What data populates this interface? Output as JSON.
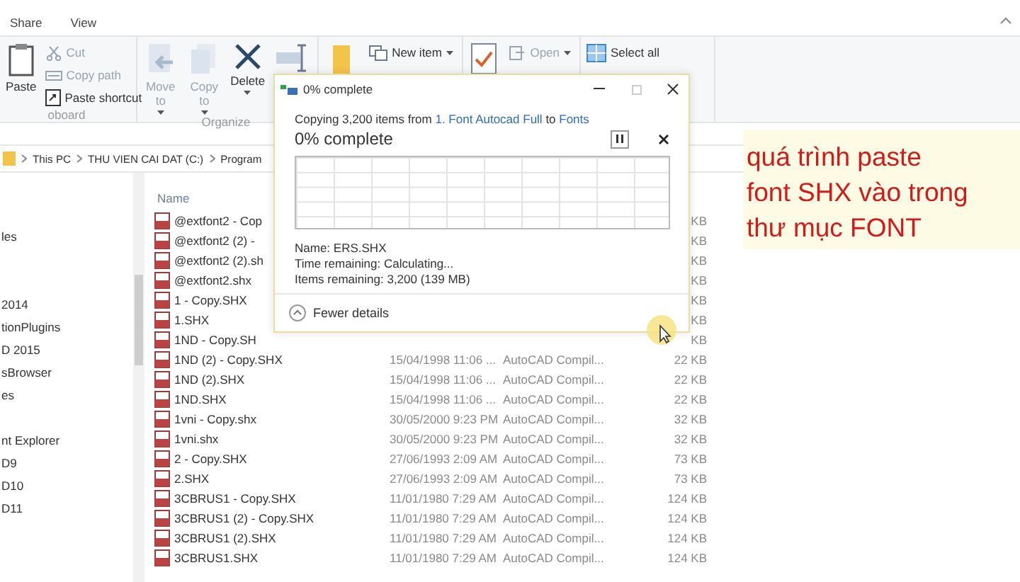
{
  "ribbon_tabs": [
    "Share",
    "View"
  ],
  "ribbon_groups": [
    {
      "label": "oboard",
      "buttons": [
        {
          "label": "Paste",
          "disabled": false
        },
        {
          "label": "Cut",
          "disabled": true
        },
        {
          "label": "Copy path",
          "disabled": true
        },
        {
          "label": "Paste shortcut",
          "disabled": false
        }
      ]
    },
    {
      "label": "Organize",
      "buttons": [
        {
          "label": "Move to",
          "disabled": true
        },
        {
          "label": "Copy to",
          "disabled": true
        },
        {
          "label": "Delete",
          "disabled": false
        }
      ]
    },
    {
      "buttons": [
        {
          "label": "New item",
          "disabled": false
        }
      ]
    },
    {
      "buttons": [
        {
          "label": "Open",
          "disabled": true
        }
      ]
    },
    {
      "buttons": [
        {
          "label": "Select all",
          "disabled": false
        }
      ]
    }
  ],
  "address_bar": {
    "crumbs": [
      "This PC",
      "THU VIEN CAI DAT (C:)",
      "Program"
    ]
  },
  "nav_sections": [
    [
      "les"
    ],
    [
      "2014",
      "tionPlugins",
      "D 2015",
      "sBrowser",
      "es"
    ],
    [
      "nt Explorer",
      "D9",
      "D10",
      "D11"
    ]
  ],
  "file_list": {
    "columns": [
      "Name"
    ],
    "rows": [
      {
        "name": "@extfont2 - Cop",
        "size": "KB"
      },
      {
        "name": "@extfont2 (2) -",
        "size": "KB"
      },
      {
        "name": "@extfont2 (2).sh",
        "size": "KB"
      },
      {
        "name": "@extfont2.shx",
        "size": "KB"
      },
      {
        "name": "1 - Copy.SHX",
        "size": "KB"
      },
      {
        "name": "1.SHX",
        "size": "KB"
      },
      {
        "name": "1ND - Copy.SH",
        "size": "KB"
      },
      {
        "name": "1ND (2) - Copy.SHX",
        "date": "15/04/1998 11:06 ...",
        "type": "AutoCAD Compil...",
        "size": "22 KB"
      },
      {
        "name": "1ND (2).SHX",
        "date": "15/04/1998 11:06 ...",
        "type": "AutoCAD Compil...",
        "size": "22 KB"
      },
      {
        "name": "1ND.SHX",
        "date": "15/04/1998 11:06 ...",
        "type": "AutoCAD Compil...",
        "size": "22 KB"
      },
      {
        "name": "1vni - Copy.shx",
        "date": "30/05/2000 9:23 PM",
        "type": "AutoCAD Compil...",
        "size": "32 KB"
      },
      {
        "name": "1vni.shx",
        "date": "30/05/2000 9:23 PM",
        "type": "AutoCAD Compil...",
        "size": "32 KB"
      },
      {
        "name": "2 - Copy.SHX",
        "date": "27/06/1993 2:09 AM",
        "type": "AutoCAD Compil...",
        "size": "73 KB"
      },
      {
        "name": "2.SHX",
        "date": "27/06/1993 2:09 AM",
        "type": "AutoCAD Compil...",
        "size": "73 KB"
      },
      {
        "name": "3CBRUS1 - Copy.SHX",
        "date": "11/01/1980 7:29 AM",
        "type": "AutoCAD Compil...",
        "size": "124 KB"
      },
      {
        "name": "3CBRUS1 (2) - Copy.SHX",
        "date": "11/01/1980 7:29 AM",
        "type": "AutoCAD Compil...",
        "size": "124 KB"
      },
      {
        "name": "3CBRUS1 (2).SHX",
        "date": "11/01/1980 7:29 AM",
        "type": "AutoCAD Compil...",
        "size": "124 KB"
      },
      {
        "name": "3CBRUS1.SHX",
        "date": "11/01/1980 7:29 AM",
        "type": "AutoCAD Compil...",
        "size": "124 KB"
      }
    ]
  },
  "copy_dialog": {
    "title": "0% complete",
    "summary_prefix": "Copying 3,200 items from ",
    "source": "1. Font Autocad Full",
    "summary_middle": " to ",
    "destination": "Fonts",
    "progress_title": "0% complete",
    "level": 0,
    "details": [
      {
        "label": "Name:",
        "value": "ERS.SHX"
      },
      {
        "label": "Time remaining:",
        "value": "Calculating..."
      },
      {
        "label": "Items remaining:",
        "value": "3,200 (139 MB)"
      }
    ],
    "toggle": "Fewer details"
  },
  "annotation": {
    "lines": [
      "quá trình paste",
      "font SHX vào trong",
      "thư mục FONT"
    ]
  }
}
